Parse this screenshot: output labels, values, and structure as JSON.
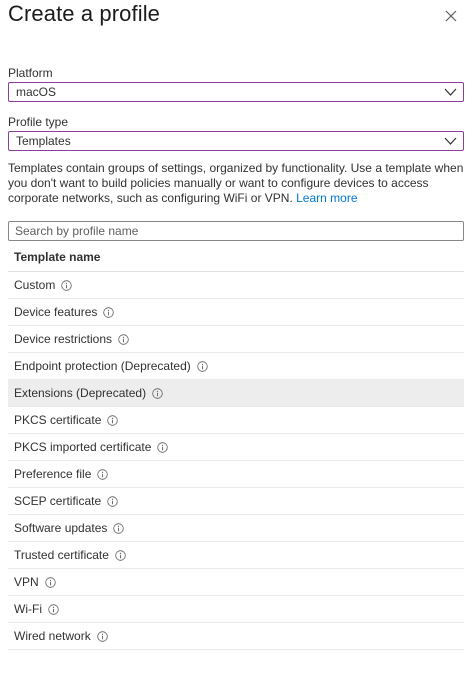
{
  "panel": {
    "title": "Create a profile",
    "close_icon": "close-icon"
  },
  "platform": {
    "label": "Platform",
    "value": "macOS"
  },
  "profile_type": {
    "label": "Profile type",
    "value": "Templates"
  },
  "description": {
    "text": "Templates contain groups of settings, organized by functionality. Use a template when you don't want to build policies manually or want to configure devices to access corporate networks, such as configuring WiFi or VPN. ",
    "link": "Learn more"
  },
  "search": {
    "placeholder": "Search by profile name",
    "value": ""
  },
  "table": {
    "header": "Template name",
    "selected_index": 4,
    "rows": [
      {
        "name": "Custom"
      },
      {
        "name": "Device features"
      },
      {
        "name": "Device restrictions"
      },
      {
        "name": "Endpoint protection (Deprecated)"
      },
      {
        "name": "Extensions (Deprecated)"
      },
      {
        "name": "PKCS certificate"
      },
      {
        "name": "PKCS imported certificate"
      },
      {
        "name": "Preference file"
      },
      {
        "name": "SCEP certificate"
      },
      {
        "name": "Software updates"
      },
      {
        "name": "Trusted certificate"
      },
      {
        "name": "VPN"
      },
      {
        "name": "Wi-Fi"
      },
      {
        "name": "Wired network"
      }
    ]
  },
  "colors": {
    "select_border": "#8a3f99",
    "link": "#0078d4",
    "selected_row": "#ededed",
    "text": "#323130"
  }
}
